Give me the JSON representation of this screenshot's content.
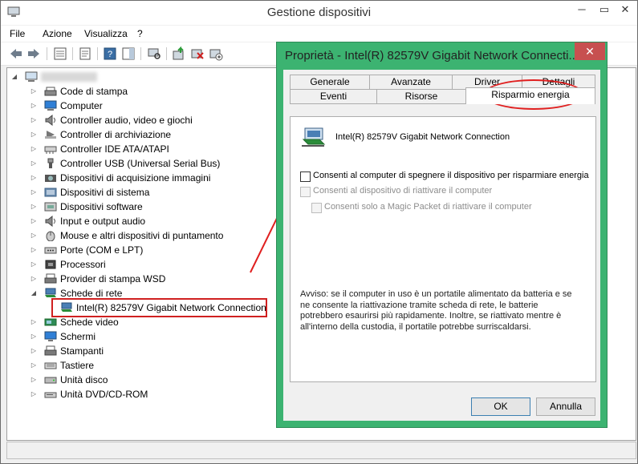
{
  "window": {
    "title": "Gestione dispositivi",
    "minimize": "─",
    "restore": "▭",
    "close": "✕"
  },
  "menu": [
    "File",
    "Azione",
    "Visualizza",
    "?"
  ],
  "tree": {
    "items": [
      {
        "label": "Code di stampa",
        "icon": "printer-queue-icon"
      },
      {
        "label": "Computer",
        "icon": "computer-icon"
      },
      {
        "label": "Controller audio, video e giochi",
        "icon": "speaker-icon"
      },
      {
        "label": "Controller di archiviazione",
        "icon": "storage-controller-icon"
      },
      {
        "label": "Controller IDE ATA/ATAPI",
        "icon": "ide-controller-icon"
      },
      {
        "label": "Controller USB (Universal Serial Bus)",
        "icon": "usb-icon"
      },
      {
        "label": "Dispositivi di acquisizione immagini",
        "icon": "camera-icon"
      },
      {
        "label": "Dispositivi di sistema",
        "icon": "system-device-icon"
      },
      {
        "label": "Dispositivi software",
        "icon": "software-device-icon"
      },
      {
        "label": "Input e output audio",
        "icon": "speaker-icon"
      },
      {
        "label": "Mouse e altri dispositivi di puntamento",
        "icon": "mouse-icon"
      },
      {
        "label": "Porte (COM e LPT)",
        "icon": "port-icon"
      },
      {
        "label": "Processori",
        "icon": "processor-icon"
      },
      {
        "label": "Provider di stampa WSD",
        "icon": "printer-icon"
      },
      {
        "label": "Schede di rete",
        "icon": "network-adapter-icon"
      },
      {
        "label": "Intel(R) 82579V Gigabit Network Connection",
        "icon": "network-adapter-icon"
      },
      {
        "label": "Schede video",
        "icon": "display-adapter-icon"
      },
      {
        "label": "Schermi",
        "icon": "monitor-icon"
      },
      {
        "label": "Stampanti",
        "icon": "printer-icon"
      },
      {
        "label": "Tastiere",
        "icon": "keyboard-icon"
      },
      {
        "label": "Unità disco",
        "icon": "disk-drive-icon"
      },
      {
        "label": "Unità DVD/CD-ROM",
        "icon": "dvd-drive-icon"
      }
    ]
  },
  "dialog": {
    "title": "Proprietà - Intel(R) 82579V Gigabit Network Connecti...",
    "close": "✕",
    "tabs_row1": [
      "Generale",
      "Avanzate",
      "Driver",
      "Dettagli"
    ],
    "tabs_row2": [
      "Eventi",
      "Risorse",
      "Risparmio energia"
    ],
    "device_name": "Intel(R) 82579V Gigabit Network Connection",
    "options": [
      {
        "label": "Consenti al computer di spegnere il dispositivo per risparmiare energia",
        "checked": false,
        "enabled": true
      },
      {
        "label": "Consenti al dispositivo di riattivare il computer",
        "checked": false,
        "enabled": false
      },
      {
        "label": "Consenti solo a Magic Packet di riattivare il computer",
        "checked": false,
        "enabled": false
      }
    ],
    "note": "Avviso: se il computer in uso è un portatile alimentato da batteria e se ne consente la riattivazione tramite scheda di rete, le batterie potrebbero esaurirsi più rapidamente. Inoltre, se riattivato mentre è all'interno della custodia, il portatile potrebbe surriscaldarsi.",
    "ok": "OK",
    "cancel": "Annulla"
  },
  "colors": {
    "highlight_red": "#e02020",
    "dialog_border": "#3cb371"
  }
}
